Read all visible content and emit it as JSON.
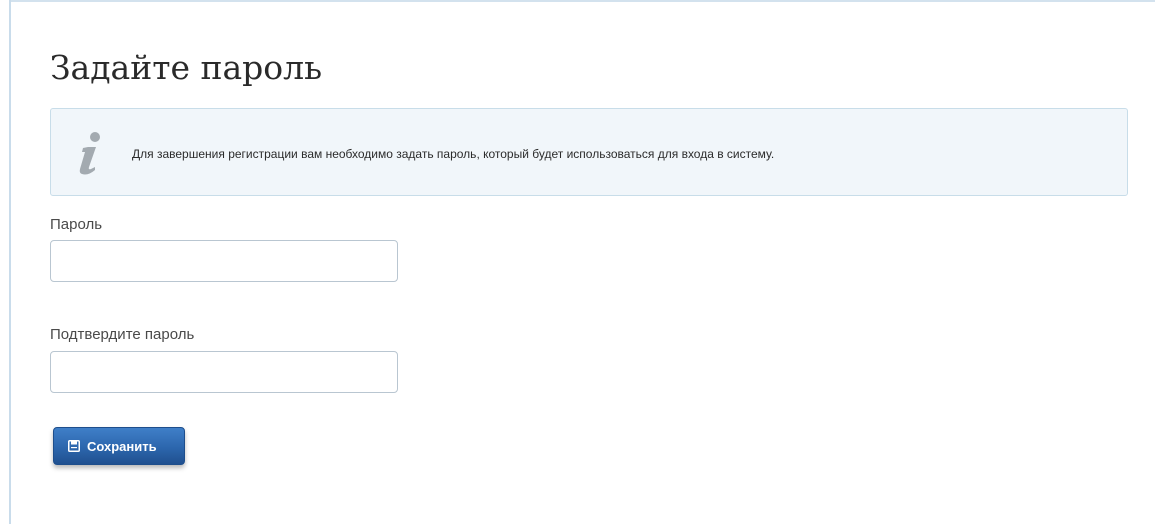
{
  "page": {
    "title": "Задайте пароль"
  },
  "info": {
    "icon": "info-icon",
    "text": "Для завершения регистрации вам необходимо задать пароль, который будет использоваться для входа в систему."
  },
  "form": {
    "password": {
      "label": "Пароль",
      "value": "",
      "placeholder": ""
    },
    "confirm_password": {
      "label": "Подтвердите пароль",
      "value": "",
      "placeholder": ""
    },
    "save_button": {
      "label": "Сохранить",
      "icon": "save-icon"
    }
  },
  "colors": {
    "info_background": "#f1f6fa",
    "info_border": "#c8dde9",
    "button_primary": "#2c66ad",
    "button_border": "#1e4e8c",
    "input_border": "#b9c6d1"
  }
}
